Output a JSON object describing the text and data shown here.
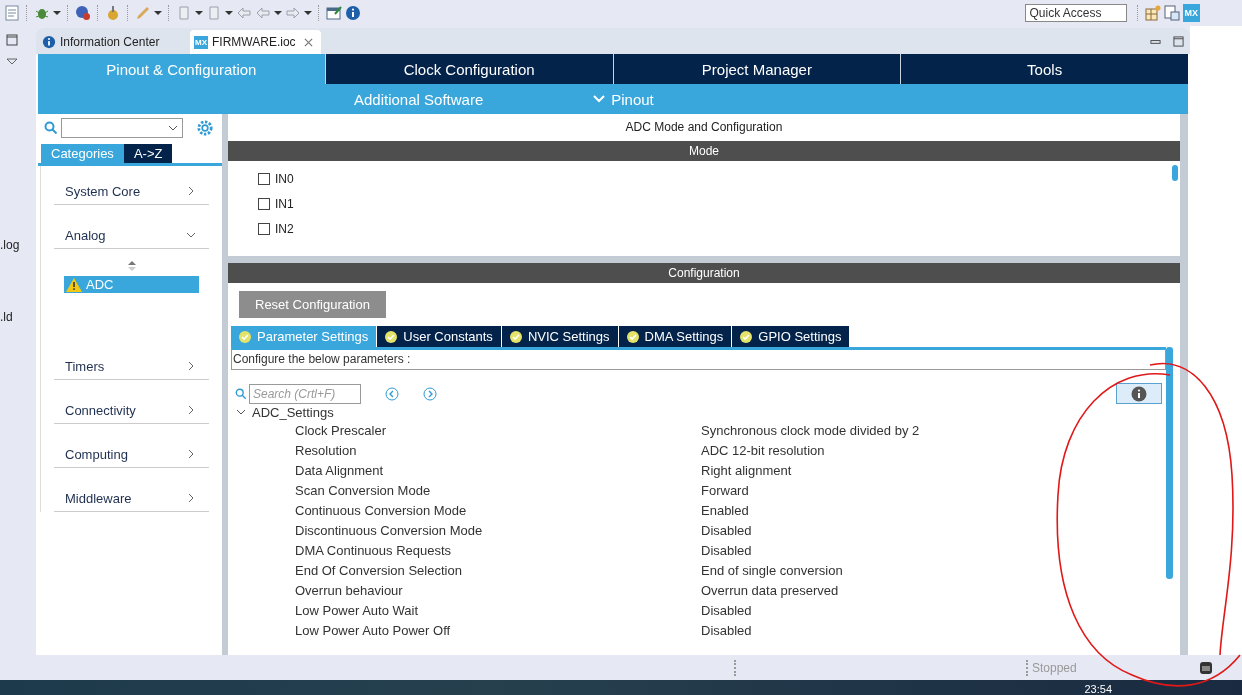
{
  "toolbar": {
    "quick_access": {
      "placeholder": "Quick Access"
    },
    "perspective_badge": "MX"
  },
  "side_strip": {
    "files": [
      ".log",
      ".ld"
    ]
  },
  "editor_tabs": [
    {
      "label": "Information Center",
      "selected": false,
      "kind": "info"
    },
    {
      "label": "FIRMWARE.ioc",
      "selected": true,
      "kind": "mx",
      "badge": "MX"
    }
  ],
  "nav_tabs": [
    {
      "label": "Pinout & Configuration",
      "selected": true
    },
    {
      "label": "Clock Configuration",
      "selected": false
    },
    {
      "label": "Project Manager",
      "selected": false
    },
    {
      "label": "Tools",
      "selected": false
    }
  ],
  "sub_nav": {
    "left": "Additional Software",
    "right": "Pinout"
  },
  "categories_panel": {
    "tabs": [
      {
        "label": "Categories",
        "selected": true
      },
      {
        "label": "A->Z",
        "selected": false
      }
    ],
    "items": [
      {
        "label": "System Core",
        "expanded": false
      },
      {
        "label": "Analog",
        "expanded": true,
        "children": [
          {
            "label": "ADC",
            "selected": true,
            "warning": true
          }
        ]
      },
      {
        "label": "Timers",
        "expanded": false
      },
      {
        "label": "Connectivity",
        "expanded": false
      },
      {
        "label": "Computing",
        "expanded": false
      },
      {
        "label": "Middleware",
        "expanded": false
      }
    ]
  },
  "config_panel": {
    "title": "ADC Mode and Configuration",
    "mode_header": "Mode",
    "mode_items": [
      {
        "label": "IN0",
        "checked": false
      },
      {
        "label": "IN1",
        "checked": false
      },
      {
        "label": "IN2",
        "checked": false
      }
    ],
    "config_header": "Configuration",
    "reset_button": "Reset Configuration",
    "tabs": [
      {
        "label": "Parameter Settings",
        "selected": true
      },
      {
        "label": "User Constants",
        "selected": false
      },
      {
        "label": "NVIC Settings",
        "selected": false
      },
      {
        "label": "DMA Settings",
        "selected": false
      },
      {
        "label": "GPIO Settings",
        "selected": false
      }
    ],
    "hint": "Configure the below parameters :",
    "search": {
      "placeholder": "Search (Crtl+F)"
    },
    "group": {
      "label": "ADC_Settings",
      "expanded": true,
      "params": [
        {
          "name": "Clock Prescaler",
          "value": "Synchronous clock mode divided by 2"
        },
        {
          "name": "Resolution",
          "value": "ADC 12-bit resolution"
        },
        {
          "name": "Data Alignment",
          "value": "Right alignment"
        },
        {
          "name": "Scan Conversion Mode",
          "value": "Forward"
        },
        {
          "name": "Continuous Conversion Mode",
          "value": "Enabled"
        },
        {
          "name": "Discontinuous Conversion Mode",
          "value": "Disabled"
        },
        {
          "name": "DMA Continuous Requests",
          "value": "Disabled"
        },
        {
          "name": "End Of Conversion Selection",
          "value": "End of single conversion"
        },
        {
          "name": "Overrun behaviour",
          "value": "Overrun data preserved"
        },
        {
          "name": "Low Power Auto Wait",
          "value": "Disabled"
        },
        {
          "name": "Low Power Auto Power Off",
          "value": "Disabled"
        }
      ]
    }
  },
  "status_bar": {
    "status": "Stopped"
  },
  "taskbar": {
    "clock": "23:54"
  }
}
